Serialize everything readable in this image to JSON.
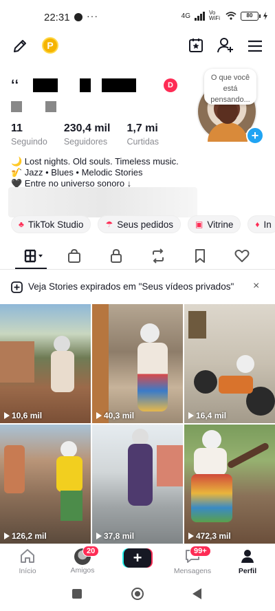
{
  "status_bar": {
    "time": "22:31",
    "more": "···",
    "network": "4G",
    "wifi_label": "Vo WiFi",
    "battery": "80"
  },
  "top_bar": {
    "coin_label": "P",
    "icons": [
      "edit-icon",
      "coins-icon",
      "calendar-star-icon",
      "add-user-icon",
      "menu-icon"
    ]
  },
  "profile": {
    "name_start": "ʻʻ",
    "note": "O que você está pensando...",
    "live_badge": "D",
    "stats": [
      {
        "value": "11",
        "label": "Seguindo"
      },
      {
        "value": "230,4 mil",
        "label": "Seguidores"
      },
      {
        "value": "1,7 mi",
        "label": "Curtidas"
      }
    ],
    "bio": [
      "🌙 Lost nights. Old souls. Timeless music.",
      "🎷 Jazz • Blues • Melodic Stories",
      "🖤 Entre no universo sonoro ↓"
    ]
  },
  "chips": [
    {
      "label": "TikTok Studio",
      "icon": "studio-icon"
    },
    {
      "label": "Seus pedidos",
      "icon": "orders-icon"
    },
    {
      "label": "Vitrine",
      "icon": "showcase-icon"
    },
    {
      "label": "In",
      "icon": "insights-icon"
    }
  ],
  "tabs": [
    "grid-icon",
    "shop-bag-icon",
    "lock-icon",
    "repost-icon",
    "bookmark-icon",
    "heart-icon"
  ],
  "banner": {
    "text": "Veja Stories expirados em \"Seus vídeos privados\"",
    "close": "×"
  },
  "videos": [
    {
      "views": "10,6 mil"
    },
    {
      "views": "40,3 mil"
    },
    {
      "views": "16,4 mil"
    },
    {
      "views": "126,2 mil"
    },
    {
      "views": "37,8 mil"
    },
    {
      "views": "472,3 mil"
    }
  ],
  "bottom_nav": [
    {
      "label": "Início",
      "badge": ""
    },
    {
      "label": "Amigos",
      "badge": "20"
    },
    {
      "label": "",
      "badge": ""
    },
    {
      "label": "Mensagens",
      "badge": "99+"
    },
    {
      "label": "Perfil",
      "badge": ""
    }
  ],
  "create_label": "+",
  "colors": {
    "brand_red": "#fe2c55",
    "brand_cyan": "#25f4ee",
    "text": "#161823",
    "muted": "#8a8b91",
    "accent_blue": "#20a4f3"
  }
}
